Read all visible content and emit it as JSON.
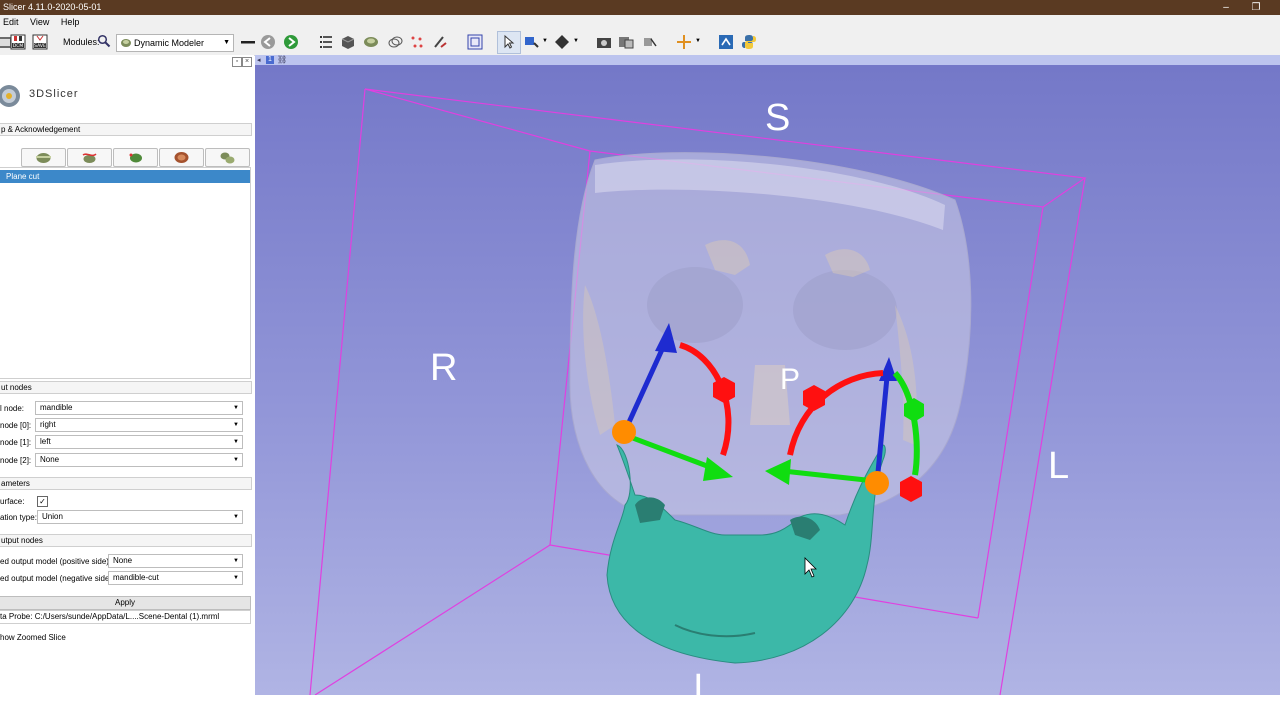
{
  "window": {
    "title": "Slicer 4.11.0-2020-05-01",
    "minimize": "–",
    "restore": "❐"
  },
  "menu": [
    "Edit",
    "View",
    "Help"
  ],
  "toolbar": {
    "modules_label": "Modules:",
    "module_selected": "Dynamic Modeler"
  },
  "panel": {
    "logo_text": "3DSlicer",
    "help_section": "p & Acknowledgement",
    "tool_icons": [
      "plane-cut-tool-icon",
      "curve-cut-tool-icon",
      "mirror-tool-icon",
      "hollow-tool-icon",
      "margin-tool-icon"
    ],
    "list_items": [
      "Plane cut"
    ],
    "input_nodes": {
      "header": "ut nodes",
      "rows": [
        {
          "label": "l node:",
          "value": "mandible"
        },
        {
          "label": "node [0]:",
          "value": "right"
        },
        {
          "label": "node [1]:",
          "value": "left"
        },
        {
          "label": "node [2]:",
          "value": "None"
        }
      ]
    },
    "parameters": {
      "header": "ameters",
      "surface_label": "urface:",
      "surface_checked": "✓",
      "operation_label": "ation type:",
      "operation_value": "Union"
    },
    "output_nodes": {
      "header": "utput nodes",
      "positive_label": "ed output model (positive side):",
      "positive_value": "None",
      "negative_label": "ed output model (negative side):",
      "negative_value": "mandible-cut"
    },
    "apply_label": "Apply",
    "data_probe": "ta Probe: C:/Users/sunde/AppData/L....Scene-Dental (1).mrml",
    "zoomed_slice": "how Zoomed Slice"
  },
  "view": {
    "number": "1",
    "pin": "◂",
    "labels": {
      "S": "S",
      "R": "R",
      "P": "P",
      "L": "L",
      "I": "I"
    },
    "colors": {
      "box": "#e040e0",
      "mandible": "#3cb8a8",
      "x_axis": "#ff1010",
      "y_axis": "#10dd10",
      "z_axis": "#1020ee",
      "origin": "#ff8c00"
    }
  }
}
